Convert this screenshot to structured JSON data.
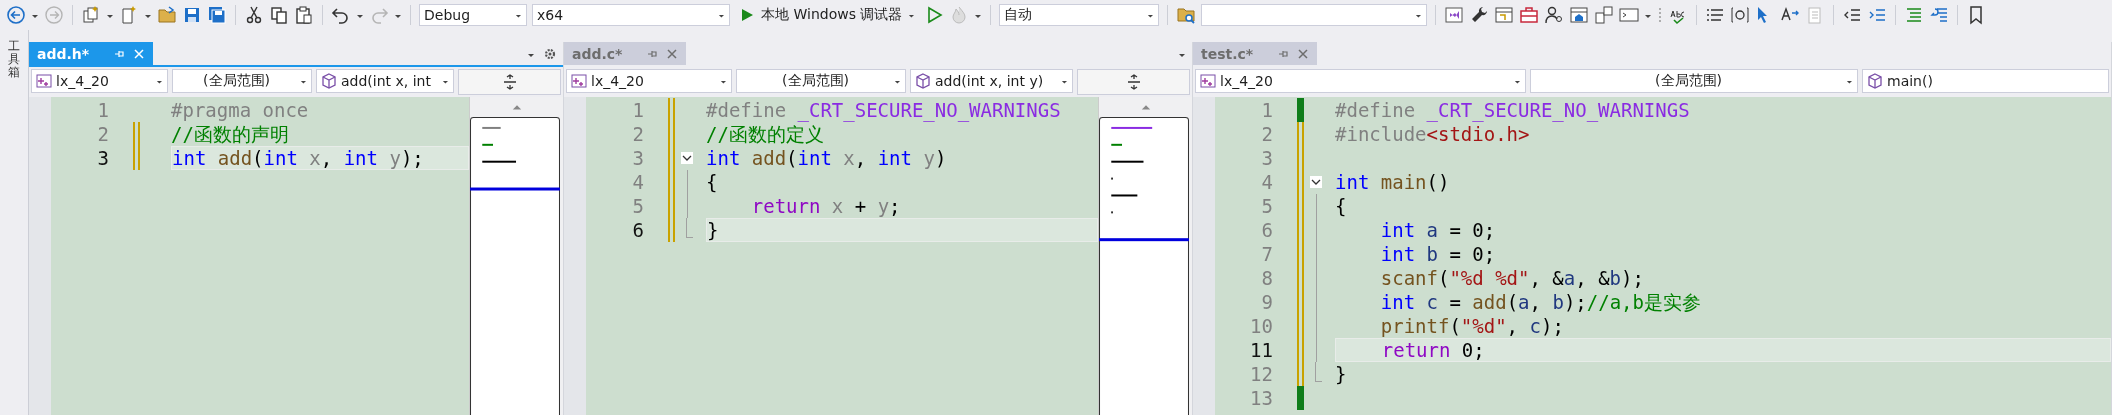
{
  "toolbar": {
    "configuration": "Debug",
    "platform": "x64",
    "run_label": "本地 Windows 调试器",
    "mode": "自动"
  },
  "side_panel": {
    "label": "工具箱"
  },
  "editors": [
    {
      "tab": {
        "title": "add.h*",
        "selected": true
      },
      "active": true,
      "overflow_menu": true,
      "minimap": true,
      "nav": {
        "project": "lx_4_20",
        "scope": "(全局范围)",
        "member": "add(int x, int"
      },
      "lines": [
        {
          "number": "1",
          "current": false,
          "changed": false,
          "saved": false,
          "fold_start": false,
          "in_fold": false,
          "tokens": [
            {
              "text": "#pragma once",
              "kind": "preprocessor"
            }
          ]
        },
        {
          "number": "2",
          "current": false,
          "changed": true,
          "saved": false,
          "fold_start": false,
          "in_fold": false,
          "tokens": [
            {
              "text": "//函数的声明",
              "kind": "comment"
            }
          ]
        },
        {
          "number": "3",
          "current": true,
          "changed": true,
          "saved": false,
          "fold_start": false,
          "in_fold": false,
          "tokens": [
            {
              "text": "int ",
              "kind": "keyword"
            },
            {
              "text": "add",
              "kind": "function"
            },
            {
              "text": "(",
              "kind": "plain"
            },
            {
              "text": "int ",
              "kind": "keyword"
            },
            {
              "text": "x",
              "kind": "parameter"
            },
            {
              "text": ", ",
              "kind": "plain"
            },
            {
              "text": "int ",
              "kind": "keyword"
            },
            {
              "text": "y",
              "kind": "parameter"
            },
            {
              "text": ");",
              "kind": "plain"
            }
          ]
        }
      ]
    },
    {
      "tab": {
        "title": "add.c*",
        "selected": false
      },
      "active": false,
      "overflow_menu": true,
      "minimap": true,
      "nav": {
        "project": "lx_4_20",
        "scope": "(全局范围)",
        "member": "add(int x, int y)"
      },
      "lines": [
        {
          "number": "1",
          "current": false,
          "changed": true,
          "saved": false,
          "fold_start": false,
          "in_fold": false,
          "tokens": [
            {
              "text": "#define ",
              "kind": "preprocessor"
            },
            {
              "text": "_CRT_SECURE_NO_WARNINGS",
              "kind": "macro"
            }
          ]
        },
        {
          "number": "2",
          "current": false,
          "changed": true,
          "saved": false,
          "fold_start": false,
          "in_fold": false,
          "tokens": [
            {
              "text": "//函数的定义",
              "kind": "comment"
            }
          ]
        },
        {
          "number": "3",
          "current": false,
          "changed": true,
          "saved": false,
          "fold_start": true,
          "in_fold": false,
          "tokens": [
            {
              "text": "int ",
              "kind": "keyword"
            },
            {
              "text": "add",
              "kind": "function"
            },
            {
              "text": "(",
              "kind": "plain"
            },
            {
              "text": "int ",
              "kind": "keyword"
            },
            {
              "text": "x",
              "kind": "parameter"
            },
            {
              "text": ", ",
              "kind": "plain"
            },
            {
              "text": "int ",
              "kind": "keyword"
            },
            {
              "text": "y",
              "kind": "parameter"
            },
            {
              "text": ")",
              "kind": "plain"
            }
          ]
        },
        {
          "number": "4",
          "current": false,
          "changed": true,
          "saved": false,
          "fold_start": false,
          "in_fold": true,
          "tokens": [
            {
              "text": "{",
              "kind": "plain"
            }
          ]
        },
        {
          "number": "5",
          "current": false,
          "changed": true,
          "saved": false,
          "fold_start": false,
          "in_fold": true,
          "tokens": [
            {
              "text": "    return ",
              "kind": "control"
            },
            {
              "text": "x",
              "kind": "parameter"
            },
            {
              "text": " + ",
              "kind": "plain"
            },
            {
              "text": "y",
              "kind": "parameter"
            },
            {
              "text": ";",
              "kind": "plain"
            }
          ]
        },
        {
          "number": "6",
          "current": true,
          "changed": true,
          "saved": false,
          "fold_start": false,
          "in_fold": true,
          "tokens": [
            {
              "text": "}",
              "kind": "plain"
            }
          ]
        }
      ]
    },
    {
      "tab": {
        "title": "test.c*",
        "selected": false
      },
      "active": false,
      "overflow_menu": false,
      "minimap": false,
      "nav": {
        "project": "lx_4_20",
        "scope": "(全局范围)",
        "member": "main()"
      },
      "lines": [
        {
          "number": "1",
          "current": false,
          "changed": true,
          "saved": true,
          "fold_start": false,
          "in_fold": false,
          "tokens": [
            {
              "text": "#define ",
              "kind": "preprocessor"
            },
            {
              "text": "_CRT_SECURE_NO_WARNINGS",
              "kind": "macro"
            }
          ]
        },
        {
          "number": "2",
          "current": false,
          "changed": true,
          "saved": false,
          "fold_start": false,
          "in_fold": false,
          "tokens": [
            {
              "text": "#include",
              "kind": "preprocessor"
            },
            {
              "text": "<stdio.h>",
              "kind": "string"
            }
          ]
        },
        {
          "number": "3",
          "current": false,
          "changed": true,
          "saved": false,
          "fold_start": false,
          "in_fold": false
        },
        {
          "number": "4",
          "current": false,
          "changed": true,
          "saved": false,
          "fold_start": true,
          "in_fold": false,
          "tokens": [
            {
              "text": "int ",
              "kind": "keyword"
            },
            {
              "text": "main",
              "kind": "function"
            },
            {
              "text": "()",
              "kind": "plain"
            }
          ]
        },
        {
          "number": "5",
          "current": false,
          "changed": true,
          "saved": false,
          "fold_start": false,
          "in_fold": true,
          "tokens": [
            {
              "text": "{",
              "kind": "plain"
            }
          ]
        },
        {
          "number": "6",
          "current": false,
          "changed": true,
          "saved": false,
          "fold_start": false,
          "in_fold": true,
          "tokens": [
            {
              "text": "    int ",
              "kind": "keyword"
            },
            {
              "text": "a",
              "kind": "local"
            },
            {
              "text": " = 0;",
              "kind": "plain"
            }
          ]
        },
        {
          "number": "7",
          "current": false,
          "changed": true,
          "saved": false,
          "fold_start": false,
          "in_fold": true,
          "tokens": [
            {
              "text": "    int ",
              "kind": "keyword"
            },
            {
              "text": "b",
              "kind": "local"
            },
            {
              "text": " = 0;",
              "kind": "plain"
            }
          ]
        },
        {
          "number": "8",
          "current": false,
          "changed": true,
          "saved": false,
          "fold_start": false,
          "in_fold": true,
          "tokens": [
            {
              "text": "    scanf",
              "kind": "function"
            },
            {
              "text": "(",
              "kind": "plain"
            },
            {
              "text": "\"%d %d\"",
              "kind": "string"
            },
            {
              "text": ", &",
              "kind": "plain"
            },
            {
              "text": "a",
              "kind": "local"
            },
            {
              "text": ", &",
              "kind": "plain"
            },
            {
              "text": "b",
              "kind": "local"
            },
            {
              "text": ");",
              "kind": "plain"
            }
          ]
        },
        {
          "number": "9",
          "current": false,
          "changed": true,
          "saved": false,
          "fold_start": false,
          "in_fold": true,
          "tokens": [
            {
              "text": "    int ",
              "kind": "keyword"
            },
            {
              "text": "c",
              "kind": "local"
            },
            {
              "text": " = ",
              "kind": "plain"
            },
            {
              "text": "add",
              "kind": "function"
            },
            {
              "text": "(",
              "kind": "plain"
            },
            {
              "text": "a",
              "kind": "local"
            },
            {
              "text": ", ",
              "kind": "plain"
            },
            {
              "text": "b",
              "kind": "local"
            },
            {
              "text": ");",
              "kind": "plain"
            },
            {
              "text": "//a,b是实参",
              "kind": "comment"
            }
          ]
        },
        {
          "number": "10",
          "current": false,
          "changed": true,
          "saved": false,
          "fold_start": false,
          "in_fold": true,
          "tokens": [
            {
              "text": "    printf",
              "kind": "function"
            },
            {
              "text": "(",
              "kind": "plain"
            },
            {
              "text": "\"%d\"",
              "kind": "string"
            },
            {
              "text": ", ",
              "kind": "plain"
            },
            {
              "text": "c",
              "kind": "local"
            },
            {
              "text": ");",
              "kind": "plain"
            }
          ]
        },
        {
          "number": "11",
          "current": true,
          "changed": true,
          "saved": false,
          "fold_start": false,
          "in_fold": true,
          "tokens": [
            {
              "text": "    return ",
              "kind": "control"
            },
            {
              "text": "0;",
              "kind": "plain"
            }
          ]
        },
        {
          "number": "12",
          "current": false,
          "changed": true,
          "saved": false,
          "fold_start": false,
          "in_fold": true,
          "tokens": [
            {
              "text": "}",
              "kind": "plain"
            }
          ]
        },
        {
          "number": "13",
          "current": false,
          "changed": true,
          "saved": true,
          "fold_start": false,
          "in_fold": false
        }
      ]
    }
  ]
}
